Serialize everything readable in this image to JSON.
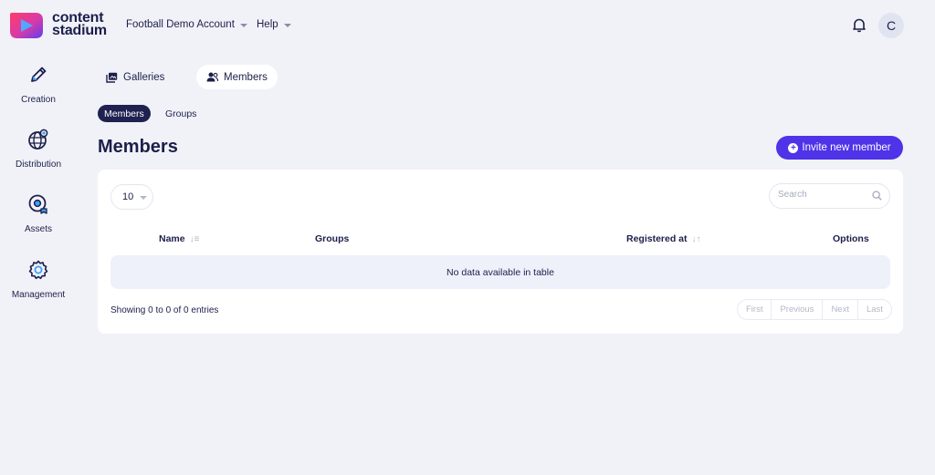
{
  "brand": {
    "line1": "content",
    "line2": "stadium"
  },
  "header": {
    "account_label": "Football Demo Account",
    "help_label": "Help",
    "avatar_initial": "C"
  },
  "sidebar": {
    "items": [
      {
        "label": "Creation",
        "icon": "pencil-icon"
      },
      {
        "label": "Distribution",
        "icon": "globe-icon"
      },
      {
        "label": "Assets",
        "icon": "assets-icon"
      },
      {
        "label": "Management",
        "icon": "gear-icon"
      }
    ]
  },
  "tabs": [
    {
      "label": "Galleries",
      "icon": "gallery-icon",
      "active": false
    },
    {
      "label": "Members",
      "icon": "users-icon",
      "active": true
    }
  ],
  "subtabs": [
    {
      "label": "Members",
      "active": true
    },
    {
      "label": "Groups",
      "active": false
    }
  ],
  "page": {
    "title": "Members",
    "invite_label": "Invite new member"
  },
  "table": {
    "page_length": "10",
    "search_placeholder": "Search",
    "columns": [
      "Name",
      "Groups",
      "Registered at",
      "Options"
    ],
    "empty_text": "No data available in table",
    "info": "Showing 0 to 0 of 0 entries",
    "pager": [
      "First",
      "Previous",
      "Next",
      "Last"
    ]
  },
  "colors": {
    "accent": "#4e33e8",
    "navy": "#1c1f4a",
    "background": "#f1f2f8"
  }
}
